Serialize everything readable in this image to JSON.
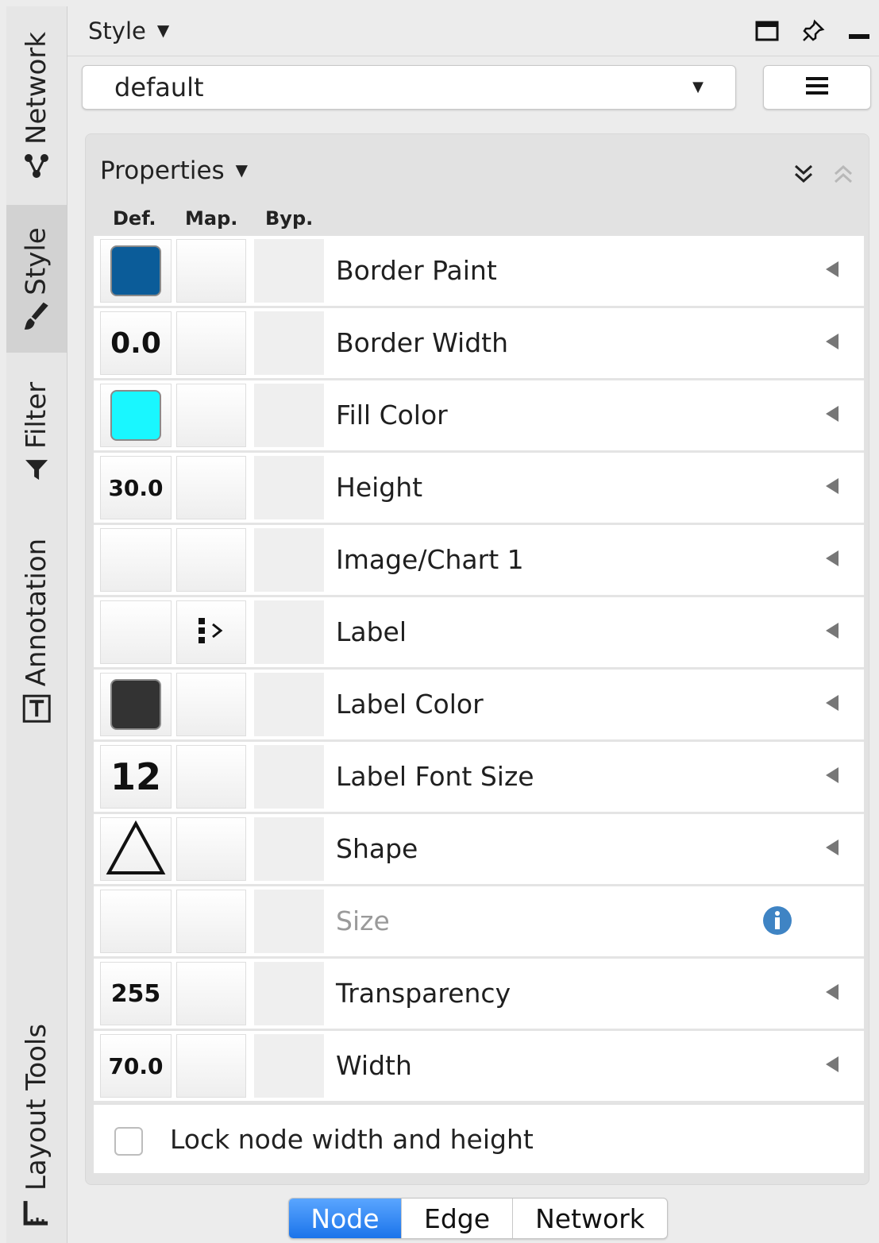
{
  "sidebar": {
    "tabs": [
      {
        "label": "Network",
        "icon": "network-icon",
        "active": false
      },
      {
        "label": "Style",
        "icon": "brush-icon",
        "active": true
      },
      {
        "label": "Filter",
        "icon": "funnel-icon",
        "active": false
      },
      {
        "label": "Annotation",
        "icon": "text-box-icon",
        "active": false
      },
      {
        "label": "Layout Tools",
        "icon": "ruler-icon",
        "active": false
      }
    ]
  },
  "titlebar": {
    "title": "Style",
    "controls": [
      "maximize-icon",
      "pin-icon",
      "minimize-icon"
    ]
  },
  "style_selector": {
    "value": "default",
    "menu_icon": "hamburger-menu-icon"
  },
  "properties": {
    "header": "Properties",
    "columns": {
      "def": "Def.",
      "map": "Map.",
      "byp": "Byp."
    },
    "rows": [
      {
        "name": "Border Paint",
        "def_type": "color",
        "def_color": "#0b5c99",
        "map": "",
        "disabled": false
      },
      {
        "name": "Border Width",
        "def_type": "text",
        "def_value": "0.0",
        "def_size": "36px",
        "map": "",
        "disabled": false
      },
      {
        "name": "Fill Color",
        "def_type": "color",
        "def_color": "#19f7ff",
        "map": "",
        "disabled": false
      },
      {
        "name": "Height",
        "def_type": "text",
        "def_value": "30.0",
        "def_size": "28px",
        "map": "",
        "disabled": false
      },
      {
        "name": "Image/Chart 1",
        "def_type": "none",
        "map": "",
        "disabled": false
      },
      {
        "name": "Label",
        "def_type": "none",
        "map": "passthrough-mapping-icon",
        "disabled": false
      },
      {
        "name": "Label Color",
        "def_type": "color",
        "def_color": "#333333",
        "map": "",
        "disabled": false
      },
      {
        "name": "Label Font Size",
        "def_type": "text",
        "def_value": "12",
        "def_size": "46px",
        "map": "",
        "disabled": false
      },
      {
        "name": "Shape",
        "def_type": "shape",
        "def_shape": "triangle-icon",
        "map": "",
        "disabled": false
      },
      {
        "name": "Size",
        "def_type": "none",
        "map": "",
        "disabled": true,
        "trailing_icon": "info-icon"
      },
      {
        "name": "Transparency",
        "def_type": "text",
        "def_value": "255",
        "def_size": "30px",
        "map": "",
        "disabled": false
      },
      {
        "name": "Width",
        "def_type": "text",
        "def_value": "70.0",
        "def_size": "28px",
        "map": "",
        "disabled": false
      }
    ],
    "lock_label": "Lock node width and height",
    "lock_checked": false
  },
  "bottom_tabs": [
    {
      "label": "Node",
      "active": true
    },
    {
      "label": "Edge",
      "active": false
    },
    {
      "label": "Network",
      "active": false
    }
  ],
  "colors": {
    "accent": "#1b74ea",
    "info": "#3f84c4"
  }
}
